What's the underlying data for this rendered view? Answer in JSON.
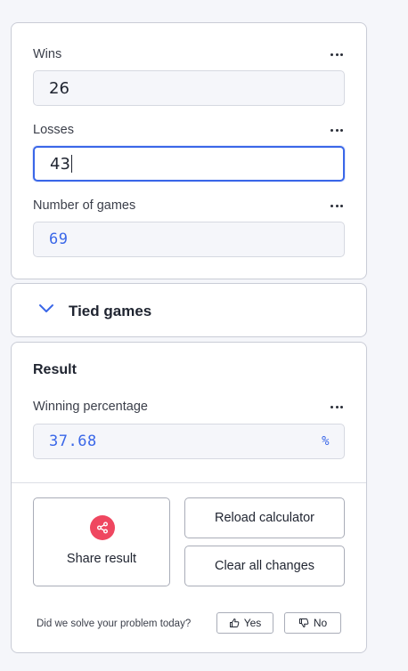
{
  "inputs": {
    "wins": {
      "label": "Wins",
      "value": "26"
    },
    "losses": {
      "label": "Losses",
      "value": "43"
    },
    "games": {
      "label": "Number of games",
      "value": "69"
    }
  },
  "tied": {
    "label": "Tied games"
  },
  "result": {
    "title": "Result",
    "winning_pct": {
      "label": "Winning percentage",
      "value": "37.68",
      "unit": "%"
    }
  },
  "actions": {
    "share": "Share result",
    "reload": "Reload calculator",
    "clear": "Clear all changes"
  },
  "feedback": {
    "question": "Did we solve your problem today?",
    "yes": "Yes",
    "no": "No"
  },
  "colors": {
    "accent": "#3a67e8",
    "share": "#ef4760",
    "border": "#c9ccd6"
  },
  "icons": [
    "more-icon",
    "chevron-down-icon",
    "share-icon",
    "thumbs-up-icon",
    "thumbs-down-icon"
  ]
}
